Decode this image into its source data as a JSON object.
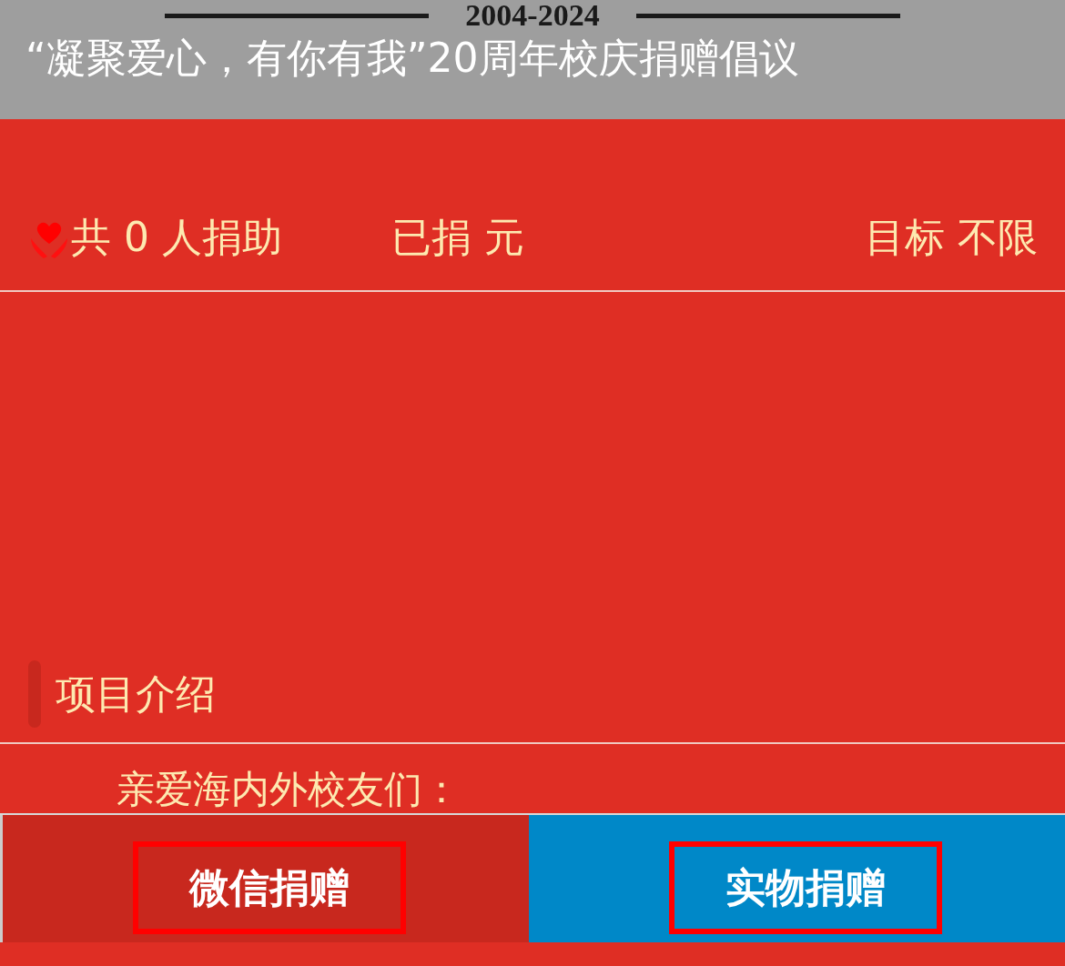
{
  "banner": {
    "year": "2004-2024",
    "title": "“凝聚爱心，有你有我”20周年校庆捐赠倡议"
  },
  "stats": {
    "donors": "共 0 人捐助",
    "raised": "已捐 元",
    "target": "目标 不限"
  },
  "section": {
    "heading": "项目介绍",
    "greeting": "亲爱海内外校友们："
  },
  "actions": [
    {
      "label": "微信捐赠",
      "kind": "wechat"
    },
    {
      "label": "实物捐赠",
      "kind": "goods"
    }
  ]
}
